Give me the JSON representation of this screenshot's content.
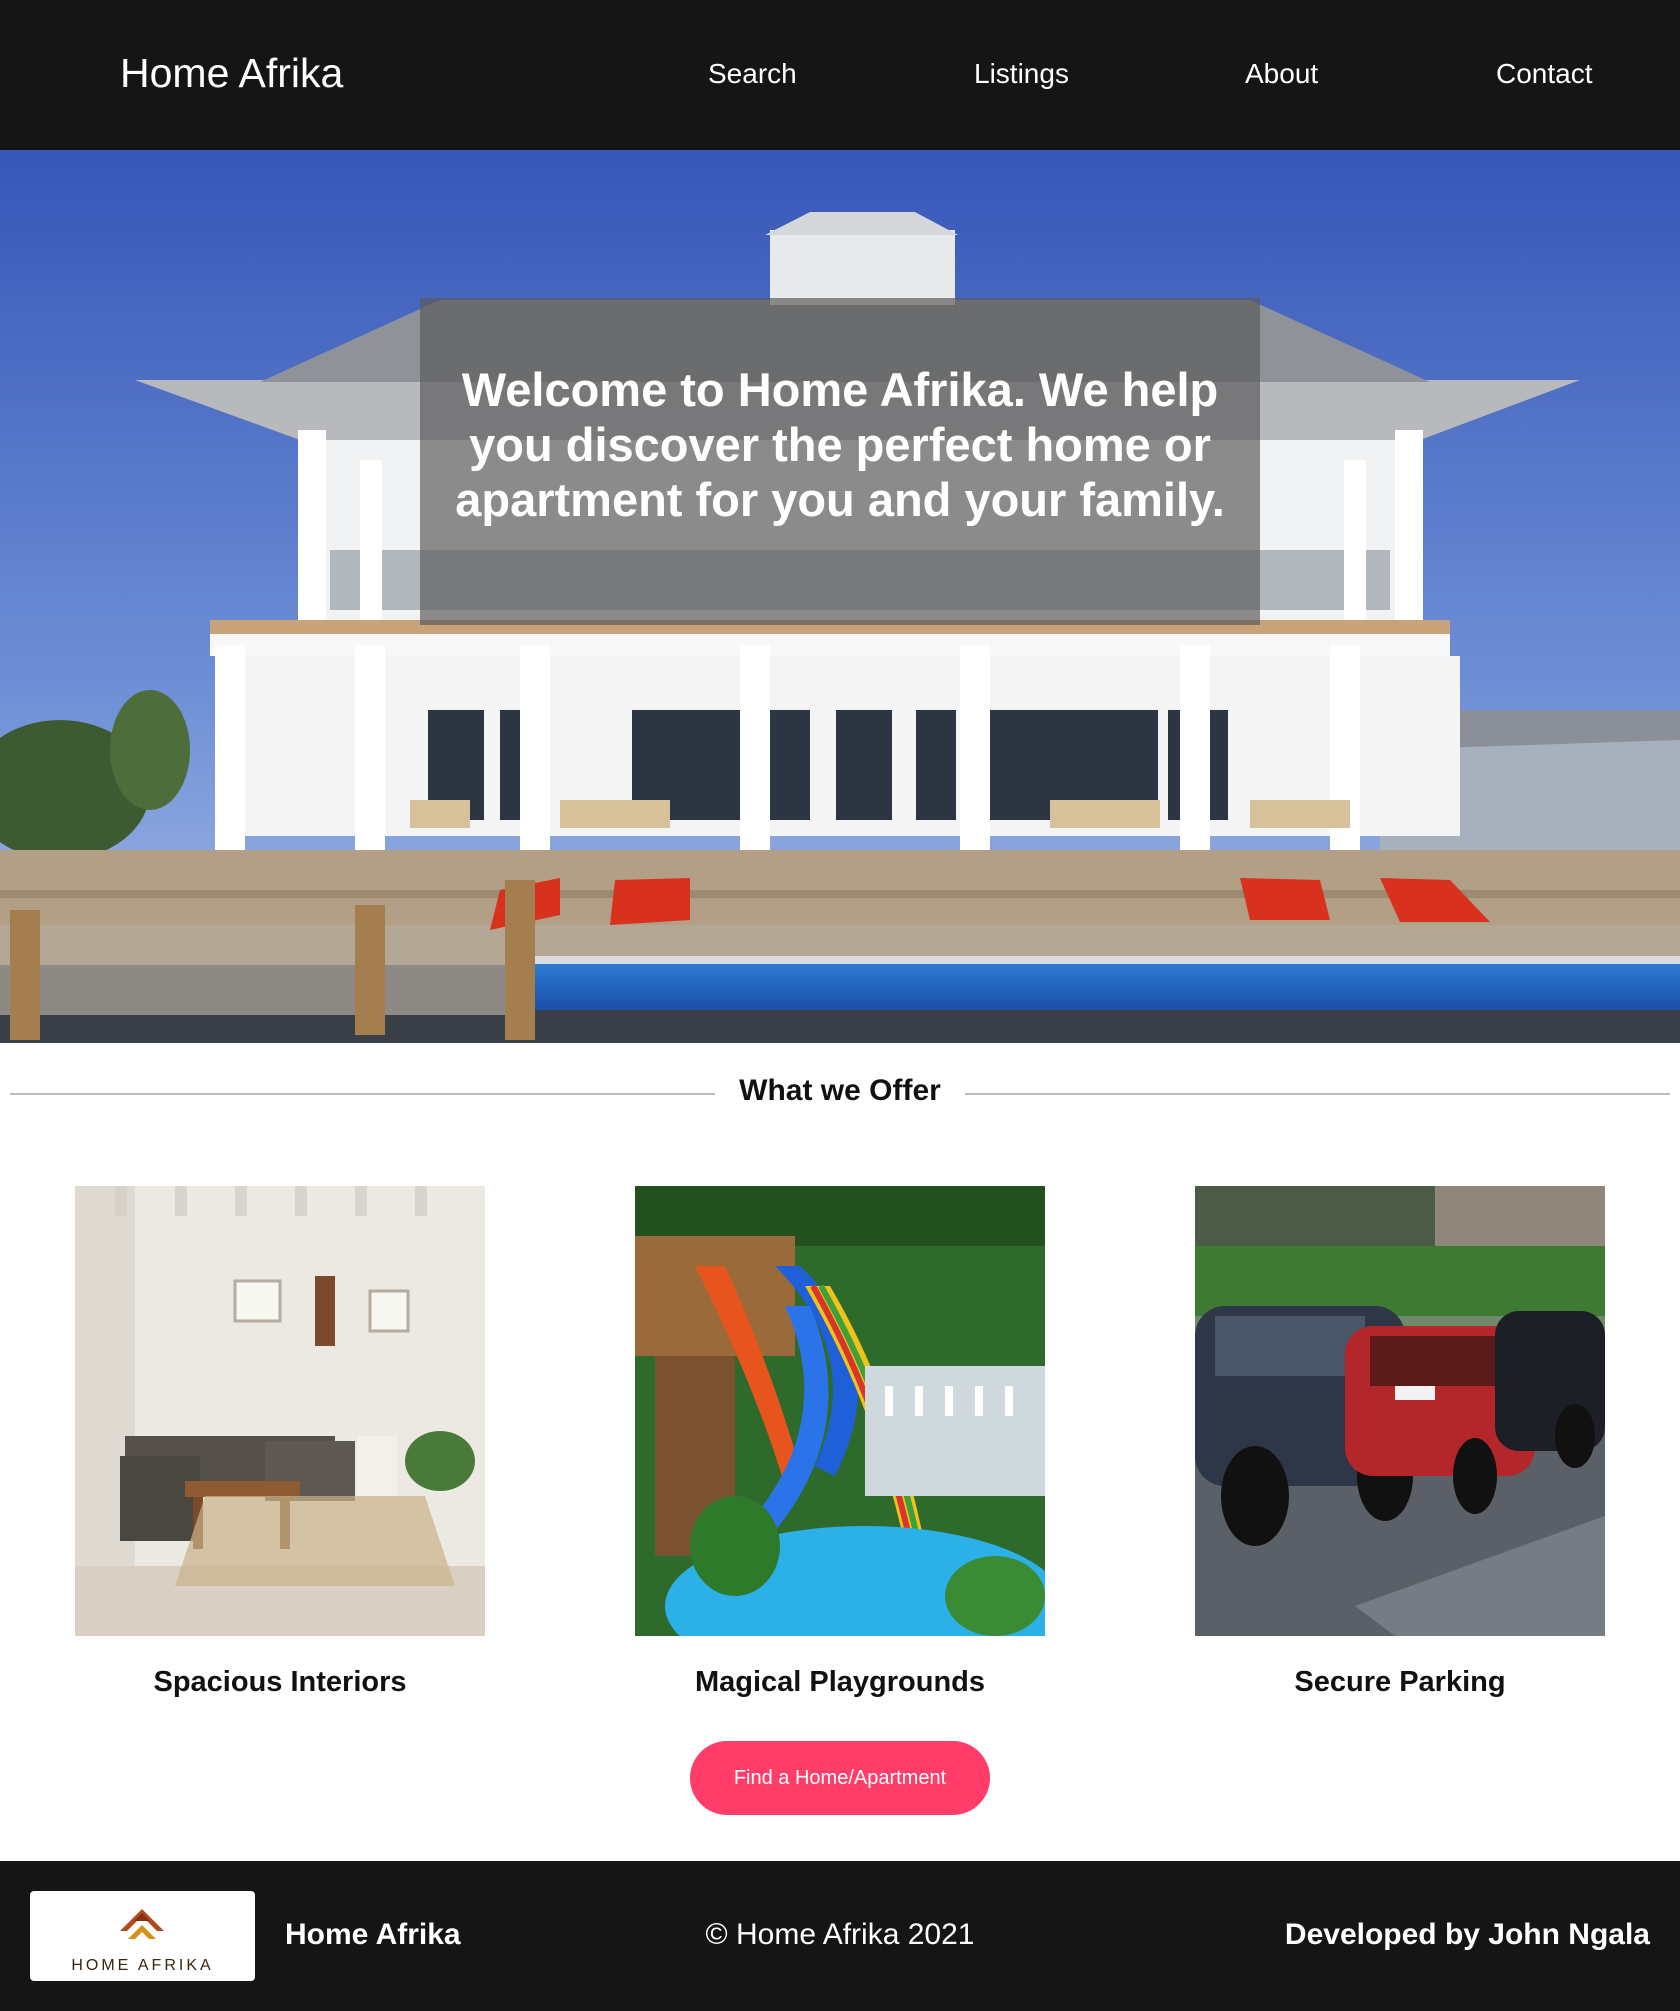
{
  "header": {
    "brand": "Home Afrika",
    "nav": [
      {
        "label": "Search"
      },
      {
        "label": "Listings"
      },
      {
        "label": "About"
      },
      {
        "label": "Contact"
      }
    ]
  },
  "hero": {
    "headline": "Welcome to Home Afrika. We help you discover the perfect home or apartment for you and your family."
  },
  "offer": {
    "title": "What we Offer",
    "cards": [
      {
        "label": "Spacious Interiors"
      },
      {
        "label": "Magical Playgrounds"
      },
      {
        "label": "Secure Parking"
      }
    ],
    "cta_label": "Find a Home/Apartment"
  },
  "footer": {
    "logo_text": "HOME AFRIKA",
    "brand": "Home Afrika",
    "copyright": "© Home Afrika 2021",
    "developer": "Developed by John Ngala"
  },
  "colors": {
    "header_bg": "#151515",
    "footer_bg": "#151515",
    "cta_bg": "#ff3d68",
    "overlay": "rgba(90,90,90,0.68)"
  }
}
